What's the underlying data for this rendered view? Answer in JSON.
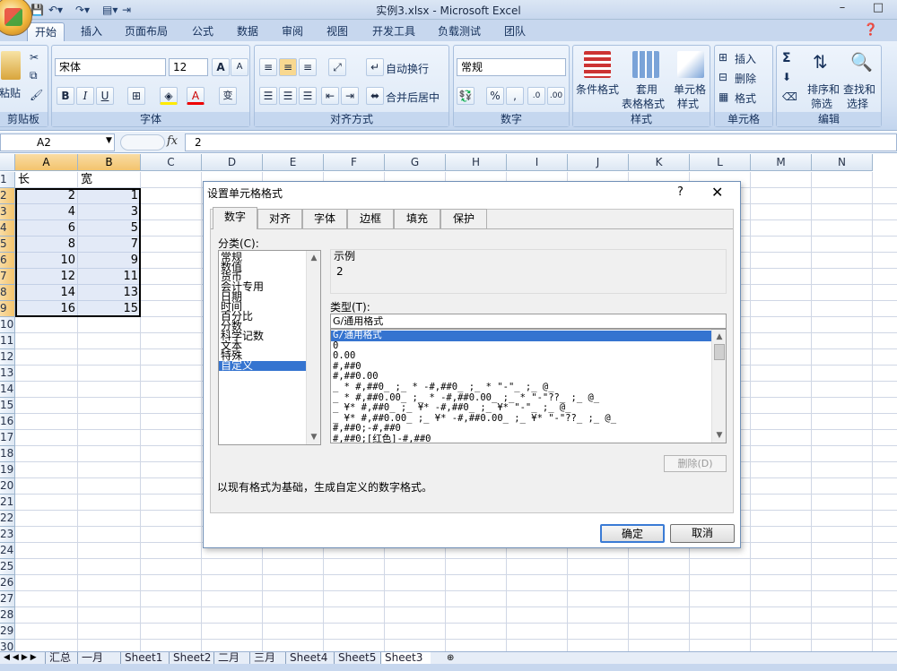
{
  "window": {
    "title": "实例3.xlsx - Microsoft Excel"
  },
  "ribbon_tabs": [
    "开始",
    "插入",
    "页面布局",
    "公式",
    "数据",
    "审阅",
    "视图",
    "开发工具",
    "负载测试",
    "团队"
  ],
  "ribbon": {
    "clipboard": {
      "paste": "粘贴",
      "label": "剪贴板"
    },
    "font": {
      "name": "宋体",
      "size": "12",
      "label": "字体",
      "grow": "A",
      "shrink": "A",
      "bold": "B",
      "italic": "I",
      "underline": "U",
      "phonetic": "变"
    },
    "alignment": {
      "wrap": "自动换行",
      "merge": "合并后居中",
      "label": "对齐方式"
    },
    "number": {
      "format": "常规",
      "percent": "%",
      "comma": ",",
      "label": "数字"
    },
    "styles": {
      "conditional": "条件格式",
      "table1": "套用",
      "table2": "表格格式",
      "cell1": "单元格",
      "cell2": "样式",
      "label": "样式"
    },
    "cells": {
      "insert": "插入",
      "delete": "删除",
      "format": "格式",
      "label": "单元格"
    },
    "editing": {
      "sum": "Σ",
      "sort1": "排序和",
      "sort2": "筛选",
      "find1": "查找和",
      "find2": "选择",
      "label": "编辑"
    }
  },
  "formula_bar": {
    "name_box": "A2",
    "fx": "fx",
    "value": "2"
  },
  "columns": [
    "A",
    "B",
    "C",
    "D",
    "E",
    "F",
    "G",
    "H",
    "I",
    "J",
    "K",
    "L",
    "M",
    "N"
  ],
  "rows": [
    "1",
    "2",
    "3",
    "4",
    "5",
    "6",
    "7",
    "8",
    "9",
    "10",
    "11",
    "12",
    "13",
    "14",
    "15",
    "16",
    "17",
    "18",
    "19",
    "20",
    "21",
    "22",
    "23",
    "24",
    "25",
    "26",
    "27",
    "28",
    "29",
    "30"
  ],
  "cells": {
    "header": [
      "长",
      "宽"
    ],
    "a": [
      "2",
      "4",
      "6",
      "8",
      "10",
      "12",
      "14",
      "16"
    ],
    "b": [
      "1",
      "3",
      "5",
      "7",
      "9",
      "11",
      "13",
      "15"
    ]
  },
  "dialog": {
    "title": "设置单元格格式",
    "help": "?",
    "close": "✕",
    "tabs": [
      "数字",
      "对齐",
      "字体",
      "边框",
      "填充",
      "保护"
    ],
    "category_label": "分类(C):",
    "categories": [
      "常规",
      "数值",
      "货币",
      "会计专用",
      "日期",
      "时间",
      "百分比",
      "分数",
      "科学记数",
      "文本",
      "特殊",
      "自定义"
    ],
    "sample_label": "示例",
    "sample_value": "2",
    "type_label": "类型(T):",
    "type_value": "G/通用格式",
    "types": [
      "G/通用格式",
      "0",
      "0.00",
      "#,##0",
      "#,##0.00",
      "_ * #,##0_ ;_ * -#,##0_ ;_ * \"-\"_ ;_ @_",
      "_ * #,##0.00_ ;_ * -#,##0.00_ ;_ * \"-\"??_ ;_ @_",
      "_ ¥* #,##0_ ;_ ¥* -#,##0_ ;_ ¥* \"-\"_ ;_ @_",
      "_ ¥* #,##0.00_ ;_ ¥* -#,##0.00_ ;_ ¥* \"-\"??_ ;_ @_",
      "#,##0;-#,##0",
      "#,##0;[红色]-#,##0"
    ],
    "delete_button": "删除(D)",
    "description": "以现有格式为基础，生成自定义的数字格式。",
    "ok": "确定",
    "cancel": "取消"
  },
  "sheet_tabs": [
    "汇总",
    "一月",
    "Sheet1",
    "Sheet2",
    "二月",
    "三月",
    "Sheet4",
    "Sheet5",
    "Sheet3"
  ],
  "active_sheet": "Sheet3"
}
